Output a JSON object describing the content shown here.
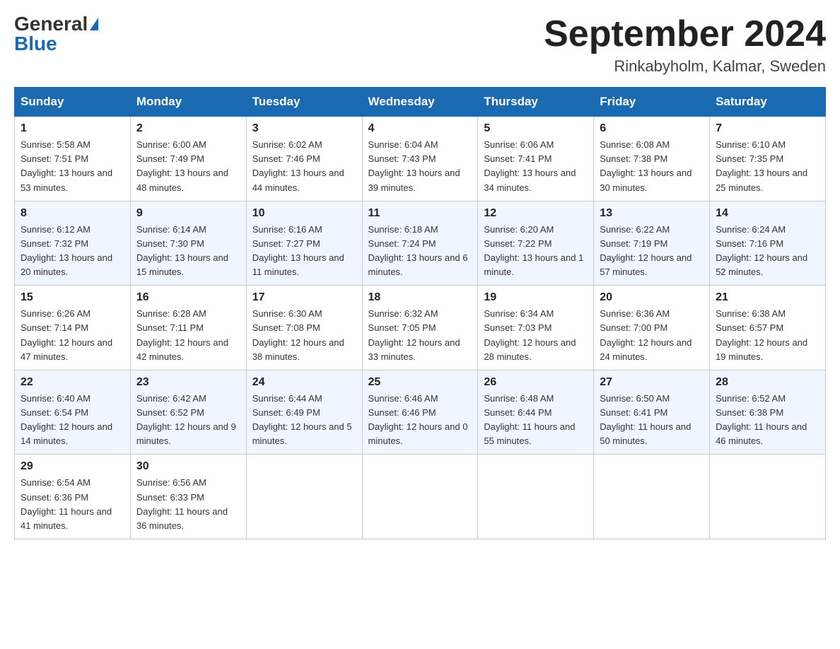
{
  "logo": {
    "general": "General",
    "blue": "Blue"
  },
  "title": {
    "month_year": "September 2024",
    "location": "Rinkabyholm, Kalmar, Sweden"
  },
  "days_of_week": [
    "Sunday",
    "Monday",
    "Tuesday",
    "Wednesday",
    "Thursday",
    "Friday",
    "Saturday"
  ],
  "weeks": [
    [
      {
        "num": "1",
        "sunrise": "Sunrise: 5:58 AM",
        "sunset": "Sunset: 7:51 PM",
        "daylight": "Daylight: 13 hours and 53 minutes."
      },
      {
        "num": "2",
        "sunrise": "Sunrise: 6:00 AM",
        "sunset": "Sunset: 7:49 PM",
        "daylight": "Daylight: 13 hours and 48 minutes."
      },
      {
        "num": "3",
        "sunrise": "Sunrise: 6:02 AM",
        "sunset": "Sunset: 7:46 PM",
        "daylight": "Daylight: 13 hours and 44 minutes."
      },
      {
        "num": "4",
        "sunrise": "Sunrise: 6:04 AM",
        "sunset": "Sunset: 7:43 PM",
        "daylight": "Daylight: 13 hours and 39 minutes."
      },
      {
        "num": "5",
        "sunrise": "Sunrise: 6:06 AM",
        "sunset": "Sunset: 7:41 PM",
        "daylight": "Daylight: 13 hours and 34 minutes."
      },
      {
        "num": "6",
        "sunrise": "Sunrise: 6:08 AM",
        "sunset": "Sunset: 7:38 PM",
        "daylight": "Daylight: 13 hours and 30 minutes."
      },
      {
        "num": "7",
        "sunrise": "Sunrise: 6:10 AM",
        "sunset": "Sunset: 7:35 PM",
        "daylight": "Daylight: 13 hours and 25 minutes."
      }
    ],
    [
      {
        "num": "8",
        "sunrise": "Sunrise: 6:12 AM",
        "sunset": "Sunset: 7:32 PM",
        "daylight": "Daylight: 13 hours and 20 minutes."
      },
      {
        "num": "9",
        "sunrise": "Sunrise: 6:14 AM",
        "sunset": "Sunset: 7:30 PM",
        "daylight": "Daylight: 13 hours and 15 minutes."
      },
      {
        "num": "10",
        "sunrise": "Sunrise: 6:16 AM",
        "sunset": "Sunset: 7:27 PM",
        "daylight": "Daylight: 13 hours and 11 minutes."
      },
      {
        "num": "11",
        "sunrise": "Sunrise: 6:18 AM",
        "sunset": "Sunset: 7:24 PM",
        "daylight": "Daylight: 13 hours and 6 minutes."
      },
      {
        "num": "12",
        "sunrise": "Sunrise: 6:20 AM",
        "sunset": "Sunset: 7:22 PM",
        "daylight": "Daylight: 13 hours and 1 minute."
      },
      {
        "num": "13",
        "sunrise": "Sunrise: 6:22 AM",
        "sunset": "Sunset: 7:19 PM",
        "daylight": "Daylight: 12 hours and 57 minutes."
      },
      {
        "num": "14",
        "sunrise": "Sunrise: 6:24 AM",
        "sunset": "Sunset: 7:16 PM",
        "daylight": "Daylight: 12 hours and 52 minutes."
      }
    ],
    [
      {
        "num": "15",
        "sunrise": "Sunrise: 6:26 AM",
        "sunset": "Sunset: 7:14 PM",
        "daylight": "Daylight: 12 hours and 47 minutes."
      },
      {
        "num": "16",
        "sunrise": "Sunrise: 6:28 AM",
        "sunset": "Sunset: 7:11 PM",
        "daylight": "Daylight: 12 hours and 42 minutes."
      },
      {
        "num": "17",
        "sunrise": "Sunrise: 6:30 AM",
        "sunset": "Sunset: 7:08 PM",
        "daylight": "Daylight: 12 hours and 38 minutes."
      },
      {
        "num": "18",
        "sunrise": "Sunrise: 6:32 AM",
        "sunset": "Sunset: 7:05 PM",
        "daylight": "Daylight: 12 hours and 33 minutes."
      },
      {
        "num": "19",
        "sunrise": "Sunrise: 6:34 AM",
        "sunset": "Sunset: 7:03 PM",
        "daylight": "Daylight: 12 hours and 28 minutes."
      },
      {
        "num": "20",
        "sunrise": "Sunrise: 6:36 AM",
        "sunset": "Sunset: 7:00 PM",
        "daylight": "Daylight: 12 hours and 24 minutes."
      },
      {
        "num": "21",
        "sunrise": "Sunrise: 6:38 AM",
        "sunset": "Sunset: 6:57 PM",
        "daylight": "Daylight: 12 hours and 19 minutes."
      }
    ],
    [
      {
        "num": "22",
        "sunrise": "Sunrise: 6:40 AM",
        "sunset": "Sunset: 6:54 PM",
        "daylight": "Daylight: 12 hours and 14 minutes."
      },
      {
        "num": "23",
        "sunrise": "Sunrise: 6:42 AM",
        "sunset": "Sunset: 6:52 PM",
        "daylight": "Daylight: 12 hours and 9 minutes."
      },
      {
        "num": "24",
        "sunrise": "Sunrise: 6:44 AM",
        "sunset": "Sunset: 6:49 PM",
        "daylight": "Daylight: 12 hours and 5 minutes."
      },
      {
        "num": "25",
        "sunrise": "Sunrise: 6:46 AM",
        "sunset": "Sunset: 6:46 PM",
        "daylight": "Daylight: 12 hours and 0 minutes."
      },
      {
        "num": "26",
        "sunrise": "Sunrise: 6:48 AM",
        "sunset": "Sunset: 6:44 PM",
        "daylight": "Daylight: 11 hours and 55 minutes."
      },
      {
        "num": "27",
        "sunrise": "Sunrise: 6:50 AM",
        "sunset": "Sunset: 6:41 PM",
        "daylight": "Daylight: 11 hours and 50 minutes."
      },
      {
        "num": "28",
        "sunrise": "Sunrise: 6:52 AM",
        "sunset": "Sunset: 6:38 PM",
        "daylight": "Daylight: 11 hours and 46 minutes."
      }
    ],
    [
      {
        "num": "29",
        "sunrise": "Sunrise: 6:54 AM",
        "sunset": "Sunset: 6:36 PM",
        "daylight": "Daylight: 11 hours and 41 minutes."
      },
      {
        "num": "30",
        "sunrise": "Sunrise: 6:56 AM",
        "sunset": "Sunset: 6:33 PM",
        "daylight": "Daylight: 11 hours and 36 minutes."
      },
      null,
      null,
      null,
      null,
      null
    ]
  ]
}
